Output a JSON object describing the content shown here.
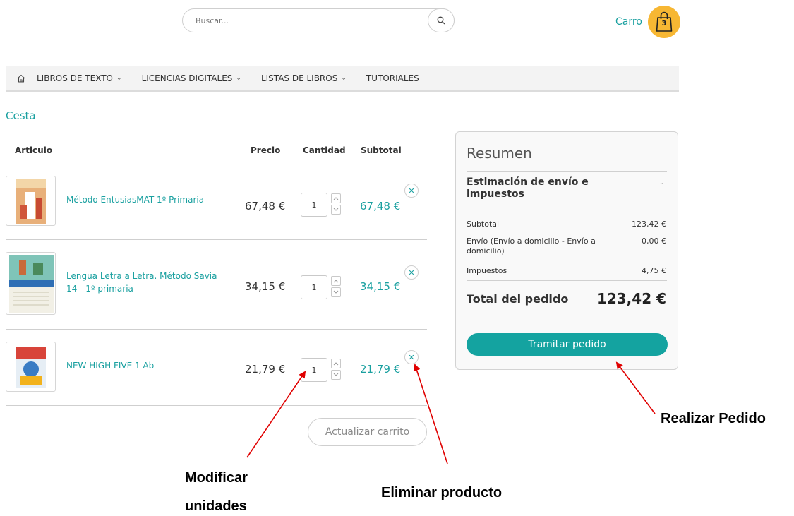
{
  "header": {
    "search_placeholder": "Buscar...",
    "cart_label": "Carro",
    "cart_count": "3"
  },
  "nav": {
    "home_icon": "home-icon",
    "items": [
      {
        "label": "LIBROS DE TEXTO",
        "has_dropdown": true
      },
      {
        "label": "LICENCIAS DIGITALES",
        "has_dropdown": true
      },
      {
        "label": "LISTAS DE LIBROS",
        "has_dropdown": true
      },
      {
        "label": "TUTORIALES",
        "has_dropdown": false
      }
    ]
  },
  "breadcrumb": "Cesta",
  "table": {
    "headers": {
      "item": "Articulo",
      "price": "Precio",
      "qty": "Cantidad",
      "subtotal": "Subtotal"
    },
    "rows": [
      {
        "name": "Método EntusiasMAT 1º Primaria",
        "price": "67,48 €",
        "qty": "1",
        "subtotal": "67,48 €"
      },
      {
        "name": "Lengua Letra a Letra. Método Savia 14 - 1º primaria",
        "price": "34,15 €",
        "qty": "1",
        "subtotal": "34,15 €"
      },
      {
        "name": "NEW HIGH FIVE 1 Ab",
        "price": "21,79 €",
        "qty": "1",
        "subtotal": "21,79 €"
      }
    ],
    "update_button": "Actualizar carrito"
  },
  "summary": {
    "title": "Resumen",
    "shipping_estimate": "Estimación de envío e impuestos",
    "subtotal_label": "Subtotal",
    "subtotal_value": "123,42 €",
    "shipping_label": "Envío (Envío a domicilio - Envío a domicilio)",
    "shipping_value": "0,00 €",
    "tax_label": "Impuestos",
    "tax_value": "4,75 €",
    "total_label": "Total del pedido",
    "total_value": "123,42 €",
    "checkout_button": "Tramitar pedido"
  },
  "annotations": {
    "place_order": "Realizar Pedido",
    "modify_units_line1": "Modificar",
    "modify_units_line2": "unidades",
    "remove_product": "Eliminar producto"
  },
  "colors": {
    "accent": "#1aa0a0",
    "cart_badge": "#f7b733",
    "arrow": "#e00000"
  }
}
